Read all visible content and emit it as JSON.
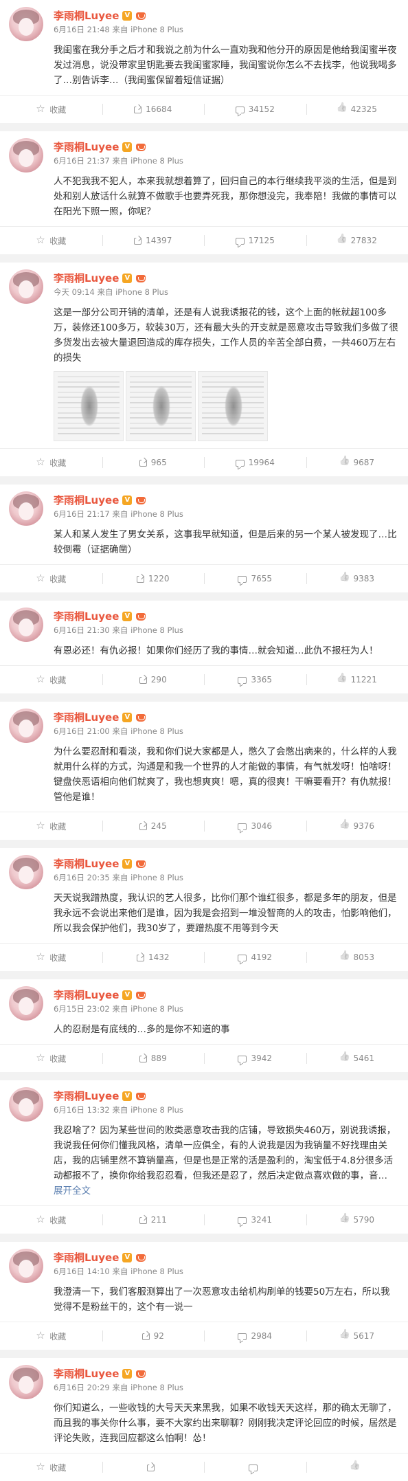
{
  "user": {
    "name": "李雨桐Luyee",
    "verified_badge": "V"
  },
  "labels": {
    "favorite": "收藏",
    "expand": "展开全文",
    "source_prefix": "来自",
    "device": "iPhone 8 Plus"
  },
  "posts": [
    {
      "time": "6月16日 21:48",
      "text": "我闺蜜在我分手之后才和我说之前为什么一直劝我和他分开的原因是他给我闺蜜半夜发过消息，说没带家里钥匙要去我闺蜜家睡，我闺蜜说你怎么不去找李，他说我喝多了…别告诉李…（我闺蜜保留着短信证据）",
      "forward": "16684",
      "comment": "34152",
      "like": "42325",
      "images": 0,
      "expand": false
    },
    {
      "time": "6月16日 21:37",
      "text": "人不犯我我不犯人，本来我就想着算了，回归自己的本行继续我平淡的生活，但是到处和别人放话什么就算不做歌手也要弄死我，那你想没完，我奉陪！我做的事情可以在阳光下照一照，你呢？",
      "forward": "14397",
      "comment": "17125",
      "like": "27832",
      "images": 0,
      "expand": false
    },
    {
      "time": "今天 09:14",
      "text": "这是一部分公司开销的清单，还是有人说我诱报花的钱，这个上面的帐就超100多万，装修还100多万，软装30万，还有最大头的开支就是恶意攻击导致我们多做了很多货发出去被大量退回造成的库存损失，工作人员的辛苦全部白费，一共460万左右的损失",
      "forward": "965",
      "comment": "19964",
      "like": "9687",
      "images": 3,
      "expand": false
    },
    {
      "time": "6月16日 21:17",
      "text": "某人和某人发生了男女关系，这事我早就知道，但是后来的另一个某人被发现了…比较倒霉（证据确凿）",
      "forward": "1220",
      "comment": "7655",
      "like": "9383",
      "images": 0,
      "expand": false
    },
    {
      "time": "6月16日 21:30",
      "text": "有恩必还！有仇必报！如果你们经历了我的事情…就会知道…此仇不报枉为人！",
      "forward": "290",
      "comment": "3365",
      "like": "11221",
      "images": 0,
      "expand": false
    },
    {
      "time": "6月16日 21:00",
      "text": "为什么要忍耐和看淡，我和你们说大家都是人，憋久了会憋出病来的，什么样的人我就用什么样的方式，沟通是和我一个世界的人才能做的事情，有气就发呀！怕啥呀！键盘侠恶语相向他们就爽了，我也想爽爽！嗯，真的很爽！干嘛要看开？有仇就报！管他是谁！",
      "forward": "245",
      "comment": "3046",
      "like": "9376",
      "images": 0,
      "expand": false
    },
    {
      "time": "6月16日 20:35",
      "text": "天天说我蹭热度，我认识的艺人很多，比你们那个谁红很多，都是多年的朋友，但是我永远不会说出来他们是谁，因为我是会招到一堆没智商的人的攻击，怕影响他们，所以我会保护他们，我30岁了，要蹭热度不用等到今天",
      "forward": "1432",
      "comment": "4192",
      "like": "8053",
      "images": 0,
      "expand": false
    },
    {
      "time": "6月15日 23:02",
      "text": "人的忍耐是有底线的…多的是你不知道的事",
      "forward": "889",
      "comment": "3942",
      "like": "5461",
      "images": 0,
      "expand": false
    },
    {
      "time": "6月16日 13:32",
      "text": "我忍啥了？因为某些世间的败类恶意攻击我的店铺，导致损失460万，别说我诱报，我说我任何你们懂我风格，清单一应俱全，有的人说我是因为我销量不好找理由关店，我的店铺里然不算销量高，但是也是正常的活是盈利的，淘宝低于4.8分很多活动都报不了，换你你给我忍忍看，但我还是忍了，然后决定做点喜欢做的事，音…",
      "forward": "211",
      "comment": "3241",
      "like": "5790",
      "images": 0,
      "expand": true
    },
    {
      "time": "6月16日 14:10",
      "text": "我澄清一下，我们客服测算出了一次恶意攻击给机构刷单的钱要50万左右，所以我觉得不是粉丝干的，这个有一说一",
      "forward": "92",
      "comment": "2984",
      "like": "5617",
      "images": 0,
      "expand": false
    },
    {
      "time": "6月16日 20:29",
      "text": "你们知道么，一些收钱的大号天天来黑我，如果不收钱天天这样，那的确太无聊了，而且我的事关你什么事，要不大家约出来聊聊？刚刚我决定评论回应的时候，居然是评论失败，连我回应都这么怕啊！怂！",
      "forward": "",
      "comment": "",
      "like": "",
      "images": 0,
      "expand": false
    }
  ]
}
